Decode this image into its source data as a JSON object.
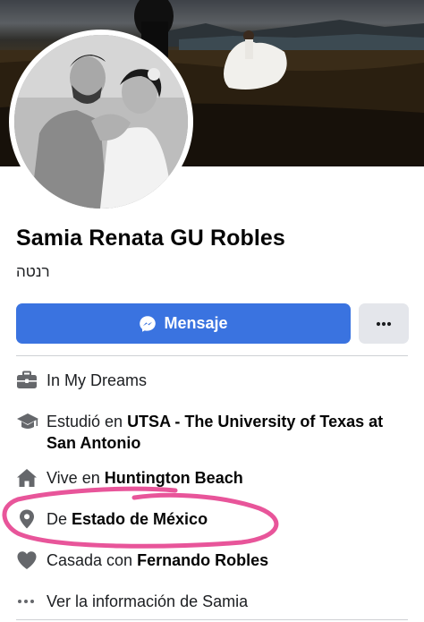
{
  "profile": {
    "name": "Samia Renata GU Robles",
    "alt_name": "רנטה"
  },
  "actions": {
    "message_label": "Mensaje"
  },
  "details": [
    {
      "icon": "briefcase-icon",
      "prefix": "In My Dreams",
      "bold": ""
    },
    {
      "icon": "graduation-cap-icon",
      "prefix": "Estudió en ",
      "bold": "UTSA - The University of Texas at San Antonio"
    },
    {
      "icon": "home-icon",
      "prefix": "Vive en ",
      "bold": "Huntington Beach"
    },
    {
      "icon": "location-pin-icon",
      "prefix": "De ",
      "bold": "Estado de México"
    },
    {
      "icon": "heart-icon",
      "prefix": "Casada con ",
      "bold": "Fernando Robles"
    },
    {
      "icon": "more-dots-icon",
      "prefix": "Ver la información de Samia",
      "bold": ""
    }
  ],
  "colors": {
    "primary_button": "#3a73e0",
    "annotation_stroke": "#e8559a"
  }
}
